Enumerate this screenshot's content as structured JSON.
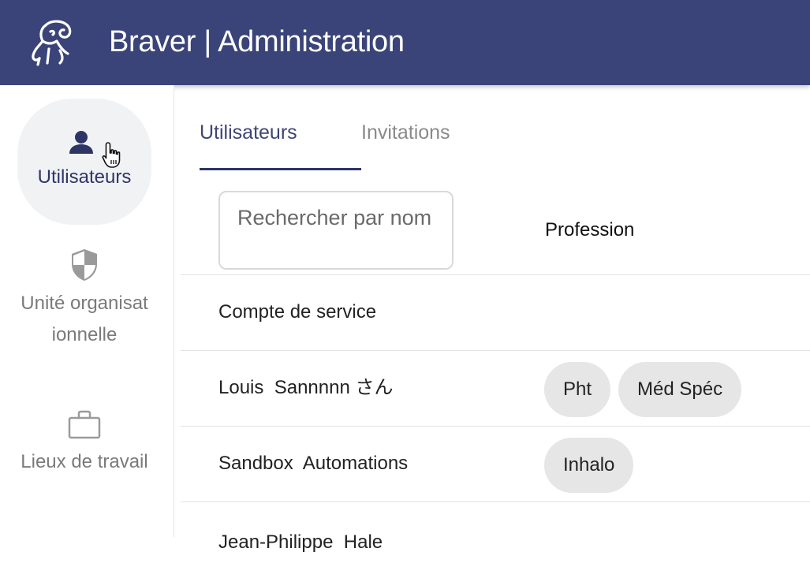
{
  "header": {
    "title": "Braver | Administration",
    "logo_icon": "ram-logo-icon",
    "background": "#3b4479"
  },
  "sidebar": {
    "items": [
      {
        "label": "Utilisateurs",
        "icon": "user-icon",
        "active": true
      },
      {
        "label": "Unité organisat ionnelle",
        "icon": "shield-icon",
        "active": false
      },
      {
        "label": "Lieux de travail",
        "icon": "briefcase-icon",
        "active": false
      }
    ]
  },
  "tabs": [
    {
      "label": "Utilisateurs",
      "active": true
    },
    {
      "label": "Invitations",
      "active": false
    }
  ],
  "search": {
    "placeholder": "Rechercher par nom"
  },
  "table": {
    "columns": [
      "Profession"
    ],
    "rows": [
      {
        "name": "Compte de service",
        "professions": []
      },
      {
        "name": "Louis  Sannnnn さん",
        "professions": [
          "Pht",
          "Méd Spéc"
        ]
      },
      {
        "name": "Sandbox  Automations",
        "professions": [
          "Inhalo"
        ]
      },
      {
        "name": "Jean-Philippe  Hale",
        "professions": []
      }
    ]
  },
  "colors": {
    "accent": "#2d3567",
    "chip_bg": "#e6e6e6"
  }
}
